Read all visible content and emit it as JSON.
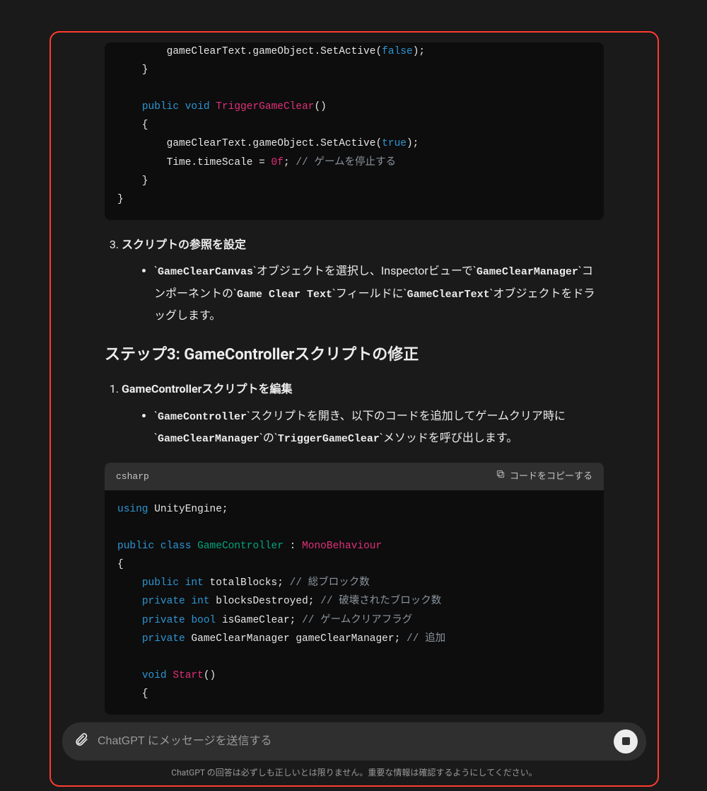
{
  "code1": {
    "lines": [
      {
        "indent": 2,
        "segments": [
          {
            "t": "gameClearText.gameObject.SetActive("
          },
          {
            "t": "false",
            "c": "kw-blue"
          },
          {
            "t": ");"
          }
        ]
      },
      {
        "indent": 1,
        "segments": [
          {
            "t": "}"
          }
        ]
      },
      {
        "indent": 0,
        "segments": [
          {
            "t": ""
          }
        ]
      },
      {
        "indent": 1,
        "segments": [
          {
            "t": "public",
            "c": "kw-blue"
          },
          {
            "t": " "
          },
          {
            "t": "void",
            "c": "kw-blue"
          },
          {
            "t": " "
          },
          {
            "t": "TriggerGameClear",
            "c": "kw-red"
          },
          {
            "t": "()"
          }
        ]
      },
      {
        "indent": 1,
        "segments": [
          {
            "t": "{"
          }
        ]
      },
      {
        "indent": 2,
        "segments": [
          {
            "t": "gameClearText.gameObject.SetActive("
          },
          {
            "t": "true",
            "c": "kw-blue"
          },
          {
            "t": ");"
          }
        ]
      },
      {
        "indent": 2,
        "segments": [
          {
            "t": "Time.timeScale = "
          },
          {
            "t": "0f",
            "c": "kw-num"
          },
          {
            "t": "; "
          },
          {
            "t": "// ゲームを停止する",
            "c": "kw-cmt"
          }
        ]
      },
      {
        "indent": 1,
        "segments": [
          {
            "t": "}"
          }
        ]
      },
      {
        "indent": 0,
        "segments": [
          {
            "t": "}"
          }
        ]
      }
    ]
  },
  "list1": {
    "start": 3,
    "item_title": "スクリプトの参照を設定",
    "bullet_parts": [
      {
        "t": "`"
      },
      {
        "t": "GameClearCanvas",
        "code": true
      },
      {
        "t": "`オブジェクトを選択し、Inspectorビューで`"
      },
      {
        "t": "GameClearManager",
        "code": true
      },
      {
        "t": "`コンポーネントの`"
      },
      {
        "t": "Game Clear Text",
        "code": true
      },
      {
        "t": "`フィールドに`"
      },
      {
        "t": "GameClearText",
        "code": true
      },
      {
        "t": "`オブジェクトをドラッグします。"
      }
    ]
  },
  "step3_heading": "ステップ3: GameControllerスクリプトの修正",
  "list2": {
    "start": 1,
    "item_title": "GameControllerスクリプトを編集",
    "bullet_parts": [
      {
        "t": "`"
      },
      {
        "t": "GameController",
        "code": true
      },
      {
        "t": "`スクリプトを開き、以下のコードを追加してゲームクリア時に`"
      },
      {
        "t": "GameClearManager",
        "code": true
      },
      {
        "t": "`の`"
      },
      {
        "t": "TriggerGameClear",
        "code": true
      },
      {
        "t": "`メソッドを呼び出します。"
      }
    ]
  },
  "code2": {
    "lang": "csharp",
    "copy_label": "コードをコピーする",
    "lines": [
      {
        "indent": 0,
        "segments": [
          {
            "t": "using",
            "c": "kw-blue"
          },
          {
            "t": " UnityEngine;"
          }
        ]
      },
      {
        "indent": 0,
        "segments": [
          {
            "t": ""
          }
        ]
      },
      {
        "indent": 0,
        "segments": [
          {
            "t": "public",
            "c": "kw-blue"
          },
          {
            "t": " "
          },
          {
            "t": "class",
            "c": "kw-blue"
          },
          {
            "t": " "
          },
          {
            "t": "GameController",
            "c": "kw-green"
          },
          {
            "t": " : "
          },
          {
            "t": "MonoBehaviour",
            "c": "kw-red"
          }
        ]
      },
      {
        "indent": 0,
        "segments": [
          {
            "t": "{"
          }
        ]
      },
      {
        "indent": 1,
        "segments": [
          {
            "t": "public",
            "c": "kw-blue"
          },
          {
            "t": " "
          },
          {
            "t": "int",
            "c": "kw-blue"
          },
          {
            "t": " totalBlocks; "
          },
          {
            "t": "// 総ブロック数",
            "c": "kw-cmt"
          }
        ]
      },
      {
        "indent": 1,
        "segments": [
          {
            "t": "private",
            "c": "kw-blue"
          },
          {
            "t": " "
          },
          {
            "t": "int",
            "c": "kw-blue"
          },
          {
            "t": " blocksDestroyed; "
          },
          {
            "t": "// 破壊されたブロック数",
            "c": "kw-cmt"
          }
        ]
      },
      {
        "indent": 1,
        "segments": [
          {
            "t": "private",
            "c": "kw-blue"
          },
          {
            "t": " "
          },
          {
            "t": "bool",
            "c": "kw-blue"
          },
          {
            "t": " isGameClear; "
          },
          {
            "t": "// ゲームクリアフラグ",
            "c": "kw-cmt"
          }
        ]
      },
      {
        "indent": 1,
        "segments": [
          {
            "t": "private",
            "c": "kw-blue"
          },
          {
            "t": " GameClearManager gameClearManager; "
          },
          {
            "t": "// 追加",
            "c": "kw-cmt"
          }
        ]
      },
      {
        "indent": 0,
        "segments": [
          {
            "t": ""
          }
        ]
      },
      {
        "indent": 1,
        "segments": [
          {
            "t": "void",
            "c": "kw-blue"
          },
          {
            "t": " "
          },
          {
            "t": "Start",
            "c": "kw-red"
          },
          {
            "t": "()"
          }
        ]
      },
      {
        "indent": 1,
        "segments": [
          {
            "t": "{"
          }
        ]
      }
    ]
  },
  "input": {
    "placeholder": "ChatGPT にメッセージを送信する"
  },
  "disclaimer": "ChatGPT の回答は必ずしも正しいとは限りません。重要な情報は確認するようにしてください。"
}
